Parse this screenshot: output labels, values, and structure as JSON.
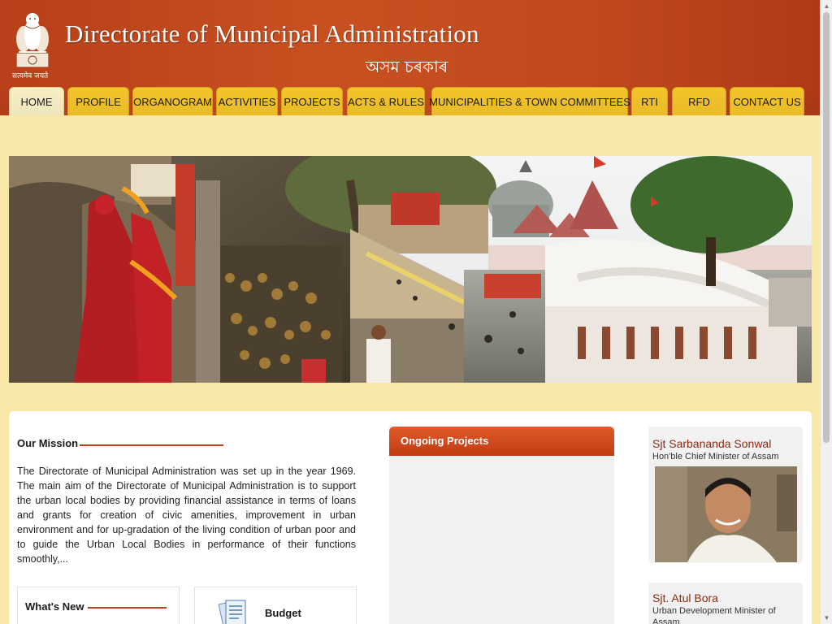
{
  "header": {
    "title": "Directorate of Municipal Administration",
    "subtitle": "অসম চৰকাৰ",
    "emblem_motto": "सत्यमेव जयते"
  },
  "nav": {
    "items": [
      {
        "label": "HOME",
        "active": true
      },
      {
        "label": "PROFILE"
      },
      {
        "label": "ORGANOGRAM"
      },
      {
        "label": "ACTIVITIES"
      },
      {
        "label": "PROJECTS"
      },
      {
        "label": "ACTS & RULES"
      },
      {
        "label": "MUNICIPALITIES & TOWN COMMITTEES"
      },
      {
        "label": "RTI"
      },
      {
        "label": "RFD"
      },
      {
        "label": "CONTACT US"
      }
    ]
  },
  "mission": {
    "title": "Our Mission",
    "text": "The Directorate of Municipal Administration was set up in the year 1969. The main aim of the Directorate of Municipal Administration is to support the urban local bodies by providing financial assistance in terms of loans and grants for creation of civic amenities, improvement in urban environment and for up-gradation of the living condition of urban poor and to guide the Urban Local Bodies in performance of their functions smoothly,..."
  },
  "whats_new": {
    "title": "What's New"
  },
  "budget": {
    "title": "Budget"
  },
  "projects": {
    "title": "Ongoing Projects"
  },
  "people": [
    {
      "name": "Sjt Sarbananda Sonwal",
      "role": "Hon'ble Chief Minister of Assam"
    },
    {
      "name": "Sjt. Atul Bora",
      "role": "Urban Development Minister of Assam"
    }
  ],
  "colors": {
    "header_bg": "#c14a1e",
    "nav_tab": "#f5c52a",
    "page_bg": "#f7e8a8",
    "accent": "#c0401c"
  }
}
